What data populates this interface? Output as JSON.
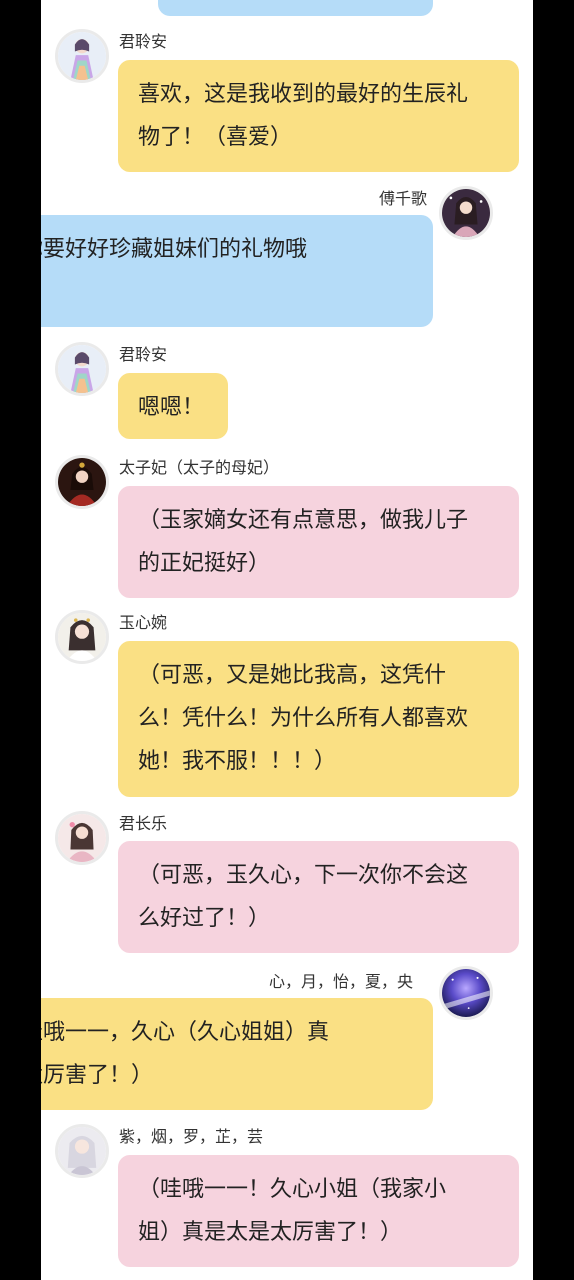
{
  "messages": [
    {
      "id": "m0",
      "side": "right",
      "sender": "",
      "lines": [
        ""
      ],
      "color": "blue"
    },
    {
      "id": "m1",
      "side": "left",
      "sender": "君聆安",
      "lines": [
        "喜欢，这是我收到的最好的生辰礼",
        "物了！（喜爱）"
      ],
      "color": "yellow",
      "avatar_icon": "portrait-rainbow-dress-icon"
    },
    {
      "id": "m2",
      "side": "right",
      "sender": "傅千歌",
      "lines": [
        "那你要好好珍藏姐妹们的礼物哦",
        "😊！"
      ],
      "color": "blue",
      "avatar_icon": "portrait-starry-icon"
    },
    {
      "id": "m3",
      "side": "left",
      "sender": "君聆安",
      "lines": [
        "嗯嗯！"
      ],
      "color": "yellow",
      "avatar_icon": "portrait-rainbow-dress-icon"
    },
    {
      "id": "m4",
      "side": "left",
      "sender": "太子妃（太子的母妃）",
      "lines": [
        "（玉家嫡女还有点意思，做我儿子",
        "的正妃挺好）"
      ],
      "color": "pink",
      "avatar_icon": "portrait-red-robe-icon"
    },
    {
      "id": "m5",
      "side": "left",
      "sender": "玉心婉",
      "lines": [
        "（可恶，又是她比我高，这凭什",
        "么！凭什么！为什么所有人都喜欢",
        "她！我不服！！！）"
      ],
      "color": "yellow",
      "avatar_icon": "portrait-white-gown-icon"
    },
    {
      "id": "m6",
      "side": "left",
      "sender": "君长乐",
      "lines": [
        "（可恶，玉久心，下一次你不会这",
        "么好过了！）"
      ],
      "color": "pink",
      "avatar_icon": "portrait-pink-flower-icon"
    },
    {
      "id": "m7",
      "side": "right",
      "sender": "心，月，怡，夏，央",
      "lines": [
        "（哇哦一一，久心（久心姐姐）真",
        "是太厉害了！）"
      ],
      "color": "yellow",
      "avatar_icon": "portrait-galaxy-icon"
    },
    {
      "id": "m8",
      "side": "left",
      "sender": "紫，烟，罗，芷，芸",
      "lines": [
        "（哇哦一一！久心小姐（我家小",
        "姐）真是太是太厉害了！）"
      ],
      "color": "pink",
      "avatar_icon": "portrait-silver-hair-icon"
    }
  ],
  "colors": {
    "yellow": "#fae084",
    "blue": "#b5dcf8",
    "pink": "#f6d3de",
    "background": "#ffffff",
    "frame": "#000000"
  }
}
